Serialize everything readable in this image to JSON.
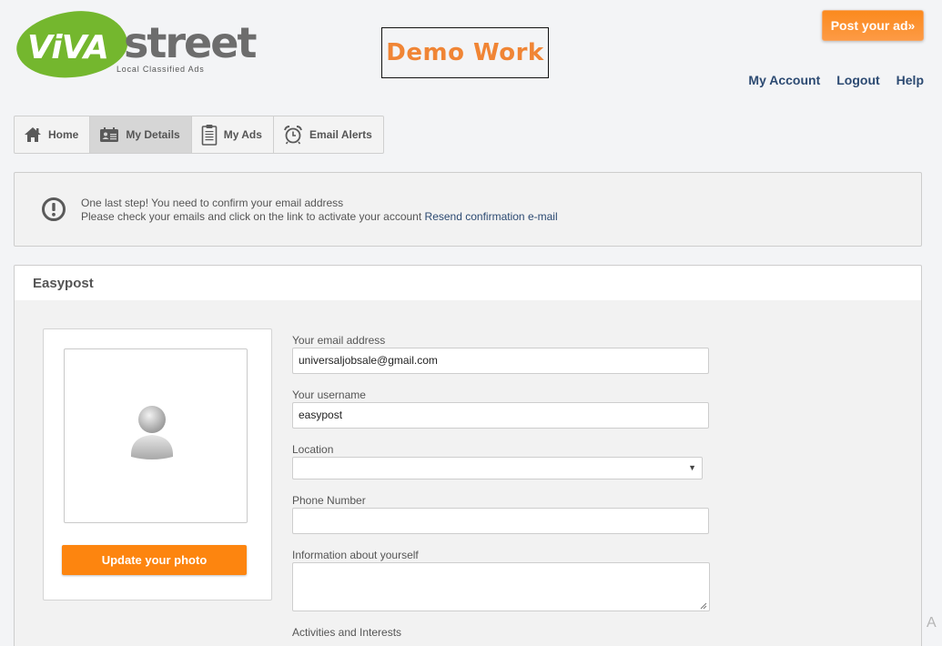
{
  "header": {
    "logo": {
      "brand_part1": "ViVA",
      "brand_part2": "street",
      "tagline": "Local Classified Ads"
    },
    "demo_label": "Demo Work",
    "post_ad_button": "Post your ad»",
    "links": [
      "My Account",
      "Logout",
      "Help"
    ]
  },
  "tabs": [
    {
      "label": "Home",
      "icon": "home-icon",
      "active": false
    },
    {
      "label": "My Details",
      "icon": "id-card-icon",
      "active": true
    },
    {
      "label": "My Ads",
      "icon": "clipboard-icon",
      "active": false
    },
    {
      "label": "Email Alerts",
      "icon": "alarm-clock-icon",
      "active": false
    }
  ],
  "notice": {
    "icon": "exclamation-circle-icon",
    "line1": "One last step! You need to confirm your email address",
    "line2": "Please check your emails and click on the link to activate your account",
    "link": "Resend confirmation e-mail"
  },
  "profile": {
    "title": "Easypost",
    "photo_button": "Update your photo",
    "avatar_icon": "default-user-icon",
    "fields": {
      "email": {
        "label": "Your email address",
        "value": "universaljobsale@gmail.com"
      },
      "username": {
        "label": "Your username",
        "value": "easypost"
      },
      "location": {
        "label": "Location",
        "value": ""
      },
      "phone": {
        "label": "Phone Number",
        "value": ""
      },
      "about": {
        "label": "Information about yourself",
        "value": ""
      },
      "activities": {
        "label": "Activities and Interests"
      }
    }
  },
  "colors": {
    "accent_orange": "#fd850f",
    "link_blue": "#2c4a72",
    "brand_green": "#74b72e",
    "demo_orange": "#f08535"
  },
  "edge_fragment": "A"
}
